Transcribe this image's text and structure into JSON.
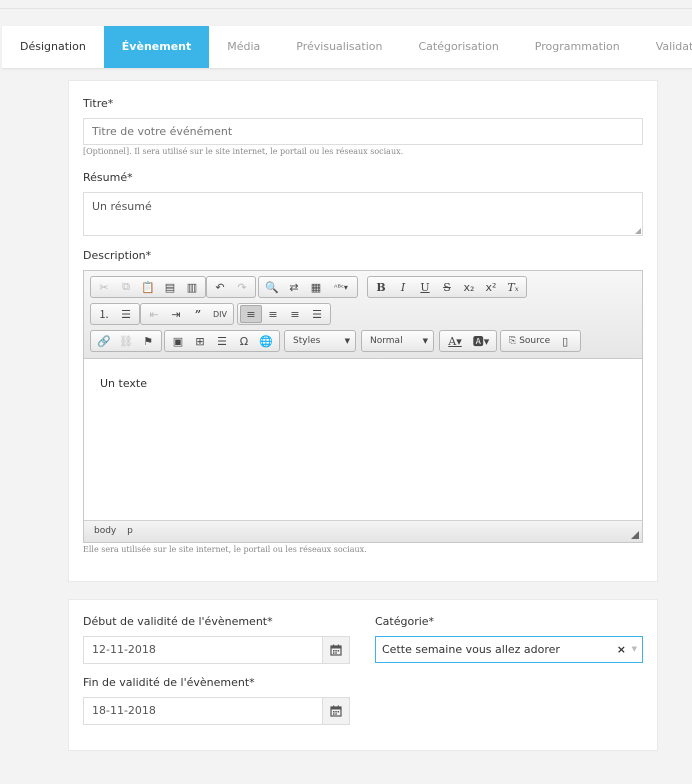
{
  "tabs": [
    {
      "label": "Désignation",
      "state": "default"
    },
    {
      "label": "Évènement",
      "state": "active"
    },
    {
      "label": "Média",
      "state": "inactive"
    },
    {
      "label": "Prévisualisation",
      "state": "inactive"
    },
    {
      "label": "Catégorisation",
      "state": "inactive"
    },
    {
      "label": "Programmation",
      "state": "inactive"
    },
    {
      "label": "Validation",
      "state": "inactive"
    }
  ],
  "form": {
    "title_label": "Titre*",
    "title_placeholder": "Titre de votre événément",
    "title_help": "[Optionnel]. Il sera utilisé sur le site internet, le portail ou les réseaux sociaux.",
    "summary_label": "Résumé*",
    "summary_placeholder": "Un résumé",
    "description_label": "Description*",
    "description_help": "Elle sera utilisée sur le site internet, le portail ou les réseaux sociaux."
  },
  "editor": {
    "styles_label": "Styles",
    "format_label": "Normal",
    "source_label": "Source",
    "content_text": "Un texte",
    "path": [
      "body",
      "p"
    ]
  },
  "validity": {
    "start_label": "Début de validité de l'évènement*",
    "start_value": "12-11-2018",
    "end_label": "Fin de validité de l'évènement*",
    "end_value": "18-11-2018",
    "category_label": "Catégorie*",
    "category_value": "Cette semaine vous allez adorer",
    "clear_symbol": "×"
  },
  "colors": {
    "accent": "#3bb5e8",
    "background": "#f3f3f4"
  }
}
